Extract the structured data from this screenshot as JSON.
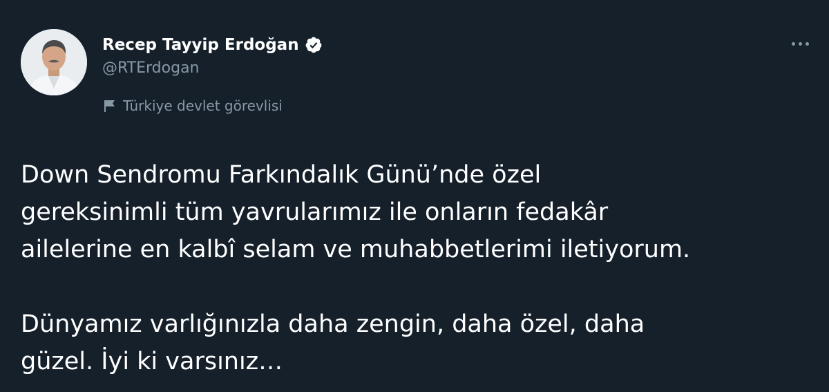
{
  "author": {
    "display_name": "Recep Tayyip Erdoğan",
    "handle": "@RTErdogan",
    "verified": true,
    "avatar_icon": "profile-photo"
  },
  "label": {
    "icon": "flag-icon",
    "text": "Türkiye devlet görevlisi"
  },
  "menu": {
    "icon": "more-icon"
  },
  "tweet": {
    "lines": [
      "Down Sendromu Farkındalık Günü’nde özel",
      "gereksinimli tüm yavrularımız ile onların fedakâr",
      "ailelerine en kalbî selam ve muhabbetlerimi iletiyorum.",
      "Dünyamız varlığınızla daha zengin, daha özel, daha",
      "güzel. İyi ki varsınız…"
    ]
  },
  "colors": {
    "background": "#15202b",
    "primary_text": "#ffffff",
    "secondary_text": "#8899a6",
    "verified_badge": "#ffffff"
  }
}
